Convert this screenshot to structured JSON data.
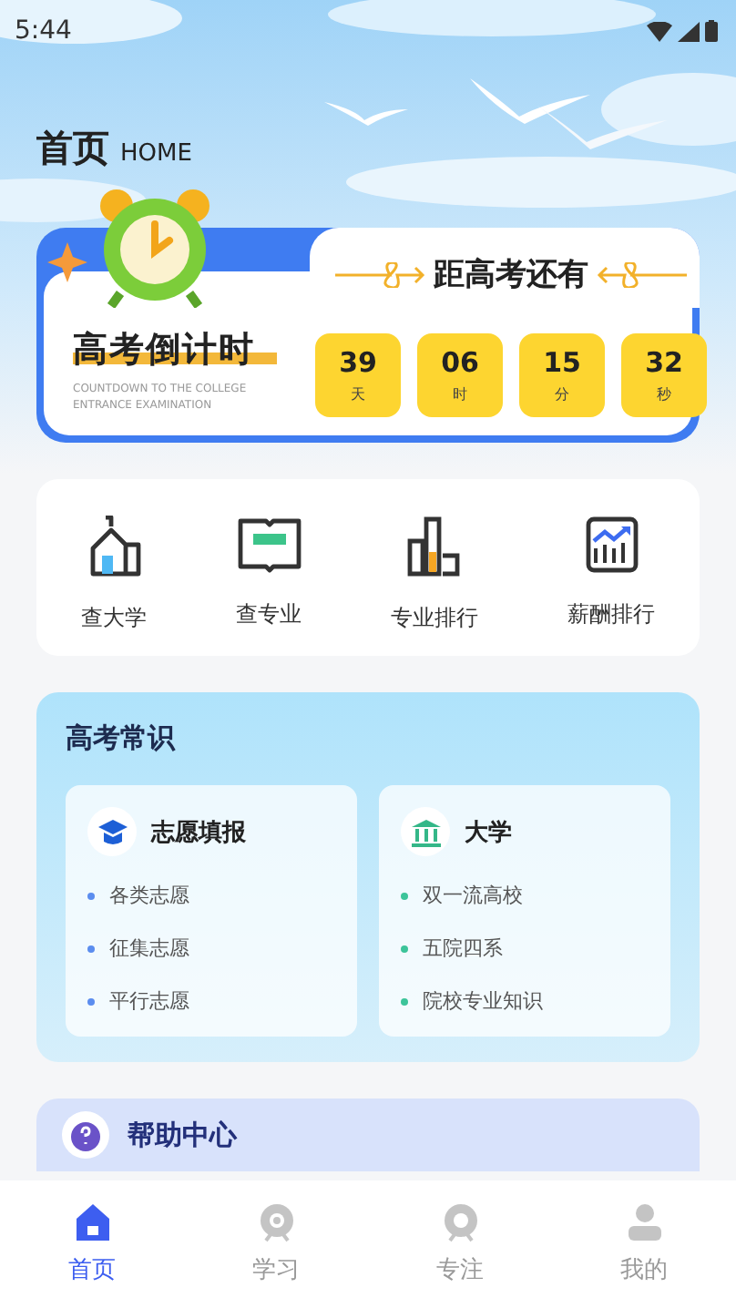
{
  "status_bar": {
    "time": "5:44"
  },
  "header": {
    "title": "首页",
    "subtitle": "HOME"
  },
  "countdown": {
    "heading": "距高考还有",
    "title": "高考倒计时",
    "subtitle": "COUNTDOWN TO THE COLLEGE ENTRANCE EXAMINATION",
    "units": [
      {
        "value": "39",
        "unit": "天"
      },
      {
        "value": "06",
        "unit": "时"
      },
      {
        "value": "15",
        "unit": "分"
      },
      {
        "value": "32",
        "unit": "秒"
      }
    ]
  },
  "shortcuts": [
    {
      "kind": "school",
      "label": "查大学"
    },
    {
      "kind": "book",
      "label": "查专业"
    },
    {
      "kind": "ranking",
      "label": "专业排行"
    },
    {
      "kind": "salary",
      "label": "薪酬排行"
    }
  ],
  "knowledge": {
    "title": "高考常识",
    "cards": [
      {
        "kind": "cap",
        "title": "志愿填报",
        "color": "#5b8def",
        "items": [
          "各类志愿",
          "征集志愿",
          "平行志愿"
        ]
      },
      {
        "kind": "building",
        "title": "大学",
        "color": "#3cc49a",
        "items": [
          "双一流高校",
          "五院四系",
          "院校专业知识"
        ]
      }
    ]
  },
  "help": {
    "title": "帮助中心"
  },
  "tabs": [
    {
      "kind": "home",
      "label": "首页",
      "selected": true
    },
    {
      "kind": "study",
      "label": "学习",
      "selected": false
    },
    {
      "kind": "focus",
      "label": "专注",
      "selected": false
    },
    {
      "kind": "mine",
      "label": "我的",
      "selected": false
    }
  ]
}
